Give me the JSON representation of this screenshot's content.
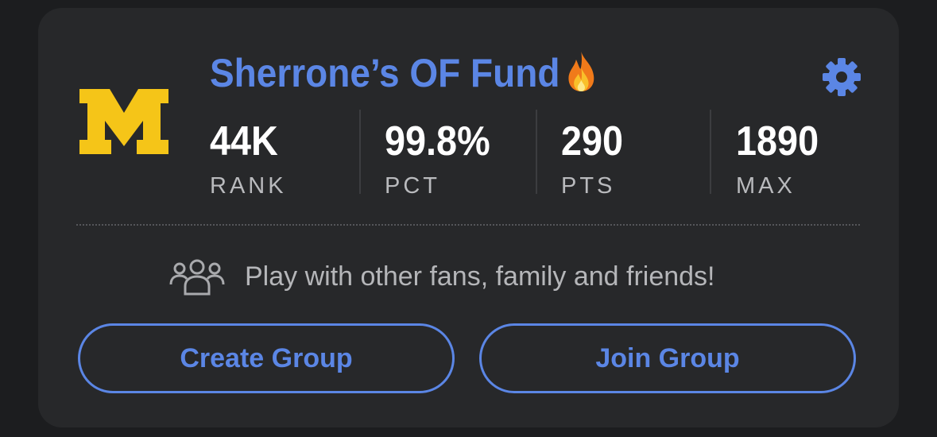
{
  "entry": {
    "team_logo": "michigan-block-m-logo",
    "team_logo_letter": "M",
    "name": "Sherrone’s OF Fund",
    "name_emoji": "fire-emoji",
    "settings_icon": "gear-icon"
  },
  "stats": [
    {
      "value": "44K",
      "label": "RANK"
    },
    {
      "value": "99.8%",
      "label": "PCT"
    },
    {
      "value": "290",
      "label": "PTS"
    },
    {
      "value": "1890",
      "label": "MAX"
    }
  ],
  "groups": {
    "icon": "group-people-icon",
    "prompt": "Play with other fans, family and friends!",
    "create_label": "Create Group",
    "join_label": "Join Group"
  },
  "colors": {
    "accent": "#5b86e5",
    "logo_maize": "#f5c518",
    "card_bg": "#27282a",
    "page_bg": "#1c1d1f",
    "stat_value": "#ffffff",
    "stat_label": "#b9babd"
  }
}
